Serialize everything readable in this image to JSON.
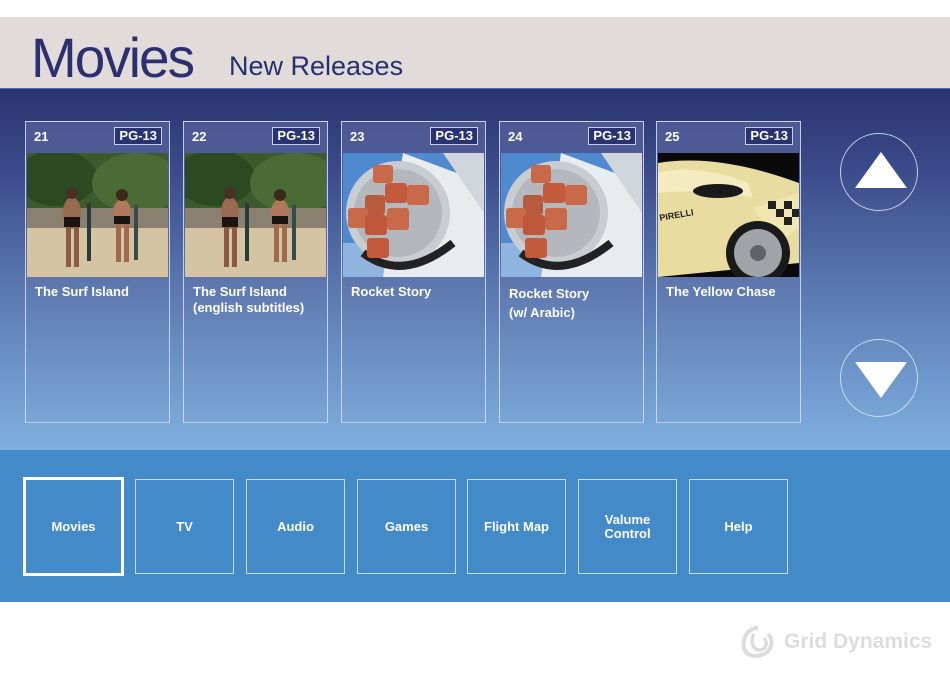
{
  "header": {
    "title": "Movies",
    "subtitle": "New Releases"
  },
  "movies": [
    {
      "number": "21",
      "rating": "PG-13",
      "title": "The Surf Island",
      "title_line2": "",
      "image": "surf-photo"
    },
    {
      "number": "22",
      "rating": "PG-13",
      "title": "The Surf Island",
      "title_line2": "(english subtitles)",
      "image": "surf-photo"
    },
    {
      "number": "23",
      "rating": "PG-13",
      "title": "Rocket Story",
      "title_line2": "",
      "image": "rocket-photo"
    },
    {
      "number": "24",
      "rating": "PG-13",
      "title": "Rocket Story",
      "title_line2": "(w/ Arabic)",
      "image": "rocket-photo"
    },
    {
      "number": "25",
      "rating": "PG-13",
      "title": "The Yellow Chase",
      "title_line2": "",
      "image": "car-photo"
    }
  ],
  "navigation": {
    "up_icon": "triangle-up-icon",
    "down_icon": "triangle-down-icon"
  },
  "menu": {
    "items": [
      {
        "label": "Movies",
        "active": true
      },
      {
        "label": "TV",
        "active": false
      },
      {
        "label": "Audio",
        "active": false
      },
      {
        "label": "Games",
        "active": false
      },
      {
        "label": "Flight Map",
        "active": false
      },
      {
        "label": "Valume Control",
        "active": false
      },
      {
        "label": "Help",
        "active": false
      }
    ]
  },
  "footer": {
    "brand": "Grid Dynamics"
  },
  "colors": {
    "header_bg": "#e1dbd9",
    "title_color": "#2a3070",
    "content_top": "#2c3470",
    "content_bottom": "#7fb0e0",
    "menu_bg": "#428ac8",
    "rating_bg": "#2a3372"
  }
}
